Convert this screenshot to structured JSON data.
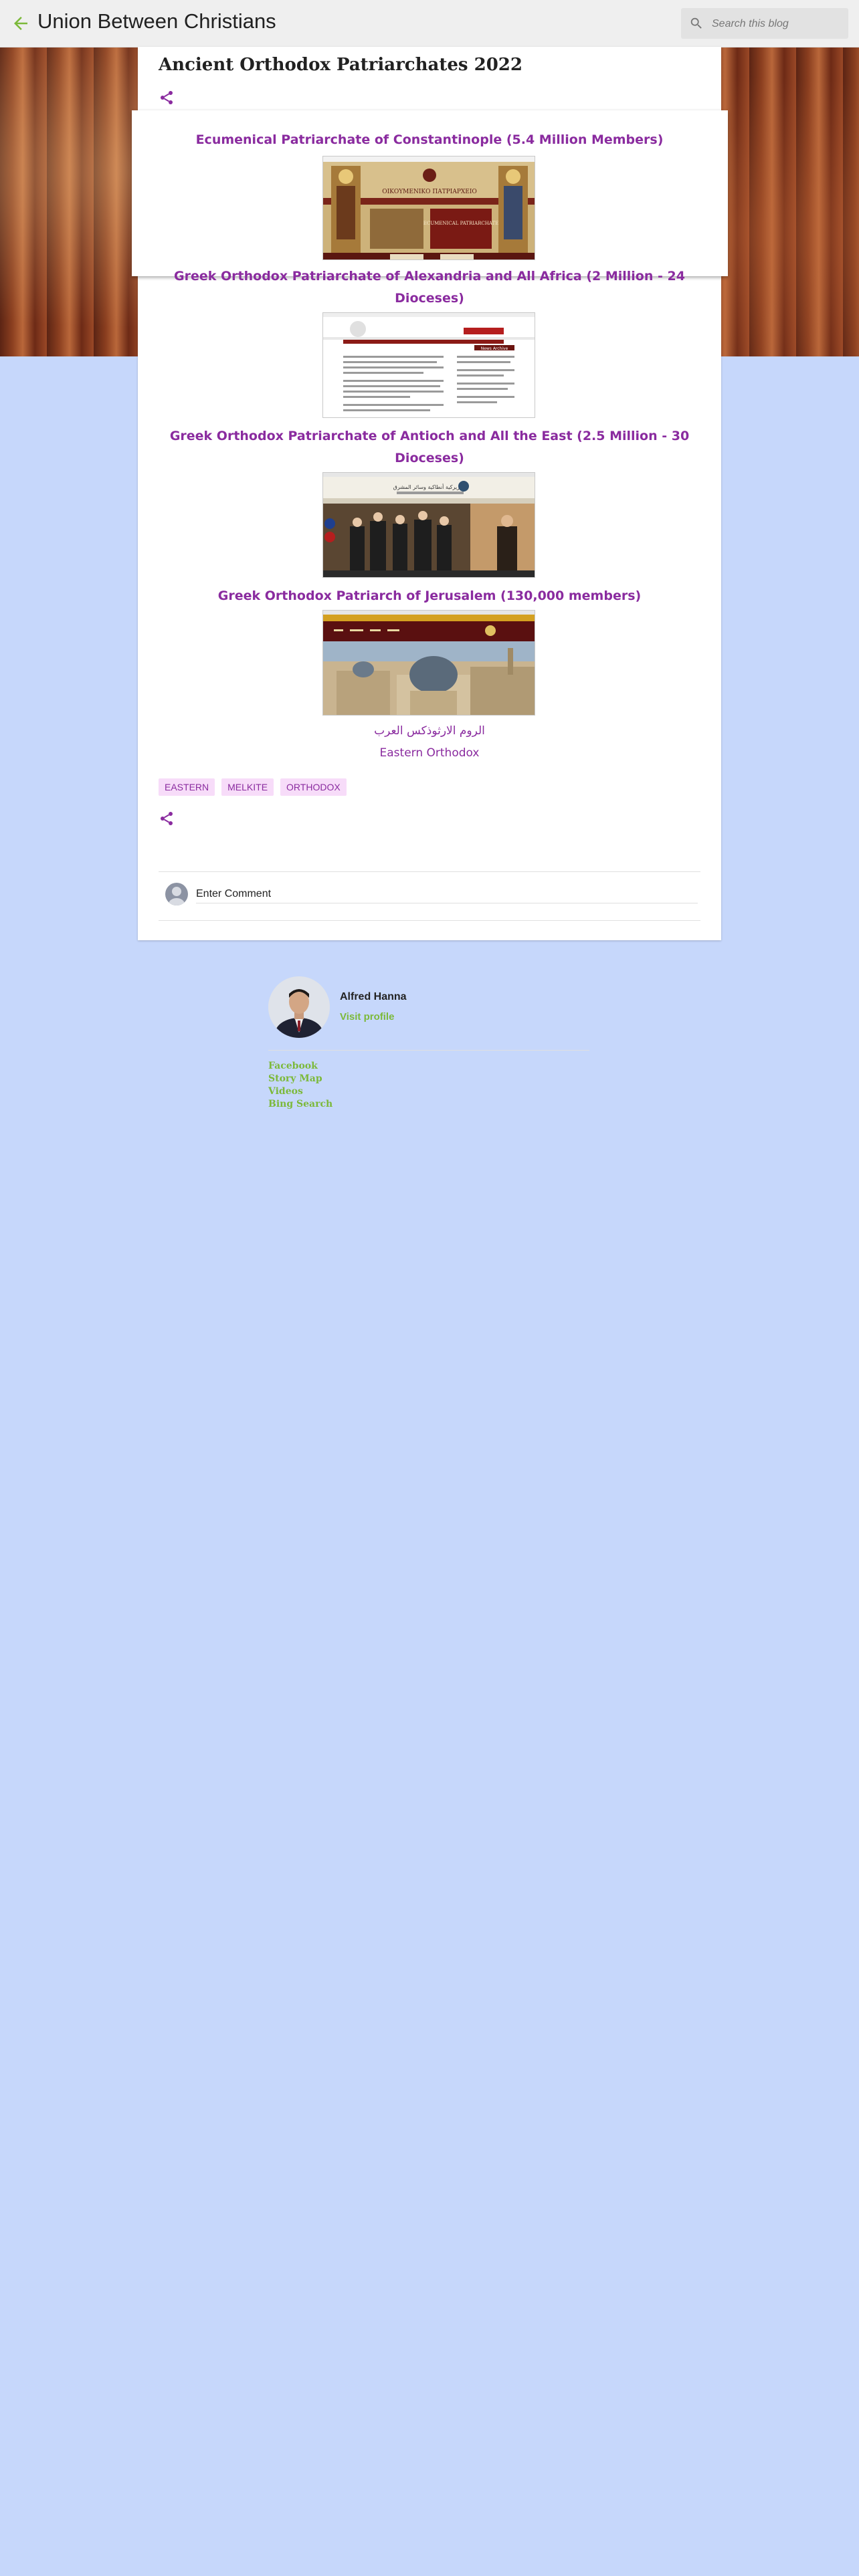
{
  "header": {
    "blog_title": "Union Between Christians",
    "search_placeholder": "Search this blog"
  },
  "post": {
    "title": "Ancient Orthodox Patriarchates 2022",
    "sections": [
      {
        "heading": "Ecumenical Patriarchate of Constantinople (5.4 Million Members)",
        "image_text": "ECUMENICAL PATRIARCHATE"
      },
      {
        "heading": "Greek Orthodox Patriarchate of Alexandria and All Africa (2 Million - 24 Dioceses)",
        "image_text": "News Archive"
      },
      {
        "heading": "Greek Orthodox Patriarchate of Antioch and All the East (2.5 Million - 30 Dioceses)",
        "image_text": "بطريركية أنطاكية وسائر المشرق"
      },
      {
        "heading": "Greek Orthodox Patriarch of Jerusalem (130,000 members)",
        "image_text": ""
      }
    ],
    "arabic_link": "الروم الارثوذكس العرب",
    "eastern_orthodox_link": "Eastern Orthodox",
    "labels": [
      "EASTERN",
      "MELKITE",
      "ORTHODOX"
    ],
    "comment_placeholder": "Enter Comment"
  },
  "profile": {
    "name": "Alfred Hanna",
    "visit_label": "Visit profile"
  },
  "footer_links": [
    "Facebook",
    "Story Map",
    "Videos",
    "Bing Search"
  ],
  "colors": {
    "accent": "#8a2b9f",
    "link_green": "#7cb93a",
    "page_bg": "#c6d7fb",
    "label_bg": "#f7dcf9"
  }
}
